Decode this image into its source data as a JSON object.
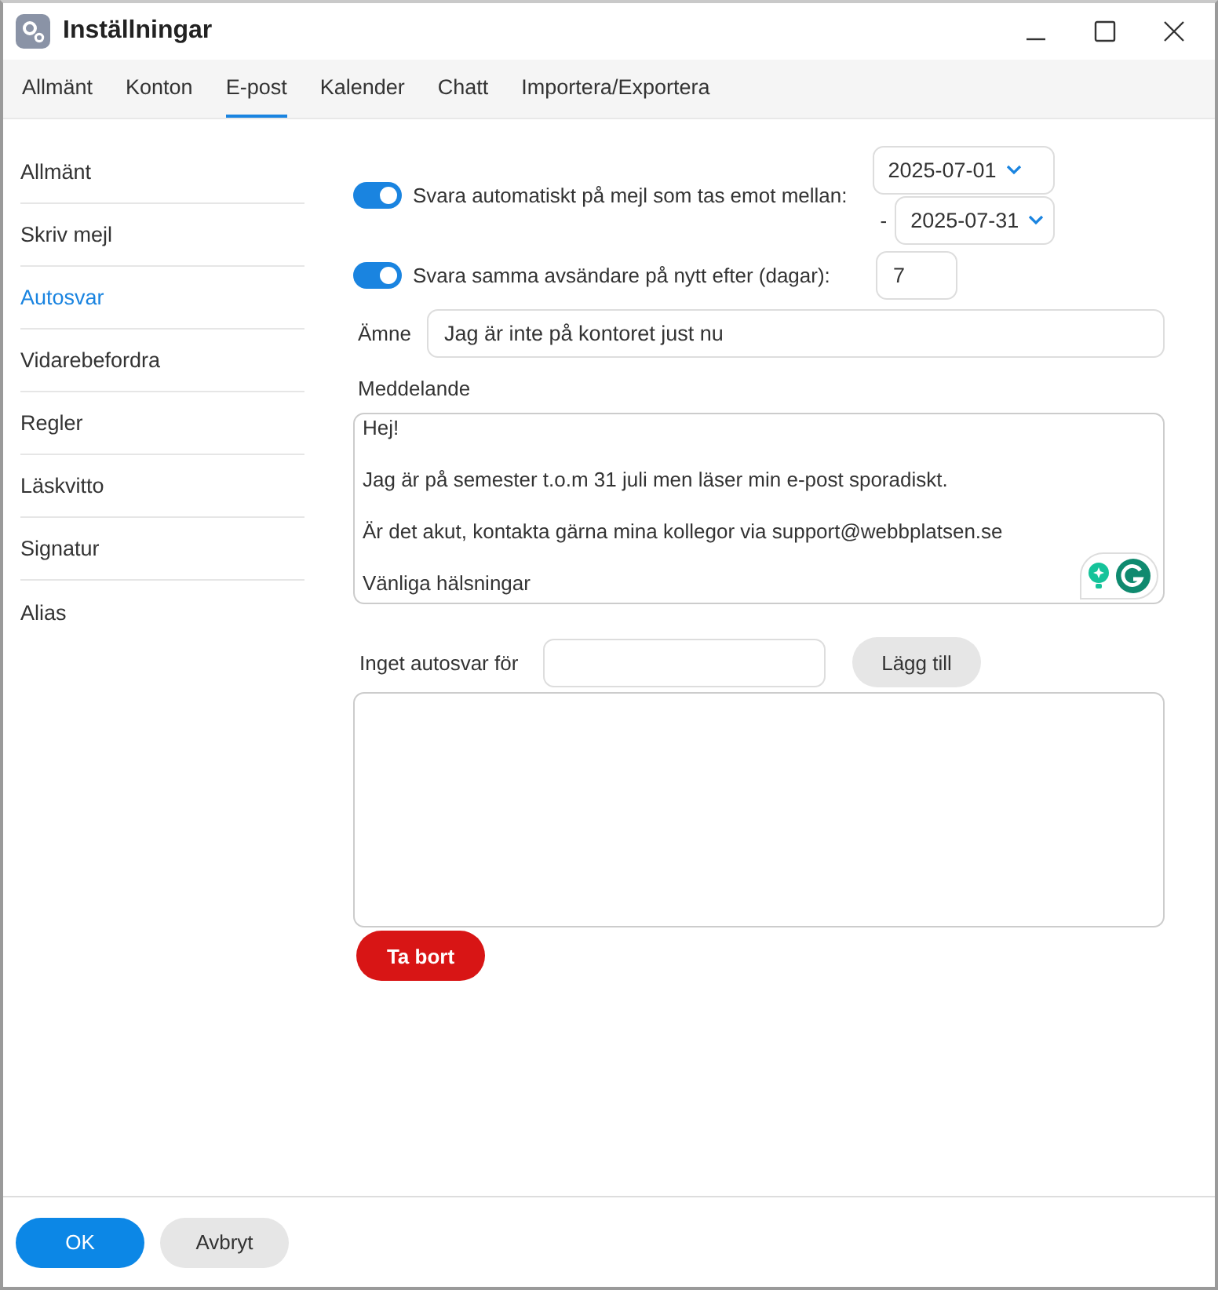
{
  "window": {
    "title": "Inställningar"
  },
  "tabs": [
    {
      "label": "Allmänt",
      "selected": false
    },
    {
      "label": "Konton",
      "selected": false
    },
    {
      "label": "E-post",
      "selected": true
    },
    {
      "label": "Kalender",
      "selected": false
    },
    {
      "label": "Chatt",
      "selected": false
    },
    {
      "label": "Importera/Exportera",
      "selected": false
    }
  ],
  "sidebar": {
    "items": [
      {
        "label": "Allmänt",
        "selected": false
      },
      {
        "label": "Skriv mejl",
        "selected": false
      },
      {
        "label": "Autosvar",
        "selected": true
      },
      {
        "label": "Vidarebefordra",
        "selected": false
      },
      {
        "label": "Regler",
        "selected": false
      },
      {
        "label": "Läskvitto",
        "selected": false
      },
      {
        "label": "Signatur",
        "selected": false
      },
      {
        "label": "Alias",
        "selected": false
      }
    ]
  },
  "auto_reply": {
    "period": {
      "on": true,
      "label": "Svara automatiskt på mejl som tas emot mellan:",
      "start": "2025-07-01",
      "separator": "-",
      "end": "2025-07-31"
    },
    "repeat": {
      "on": true,
      "label": "Svara samma avsändare på nytt efter (dagar):",
      "value": "7"
    },
    "subject": {
      "label": "Ämne",
      "value": "Jag är inte på kontoret just nu"
    },
    "message": {
      "label": "Meddelande",
      "value": "Hej!\n\nJag är på semester t.o.m 31 juli men läser min e-post sporadiskt.\n\nÄr det akut, kontakta gärna mina kollegor via support@webbplatsen.se\n\nVänliga hälsningar"
    },
    "exclude": {
      "label": "Inget autosvar för",
      "add_button": "Lägg till",
      "remove_button": "Ta bort"
    }
  },
  "footer": {
    "buttons": [
      {
        "label": "OK",
        "kind": "primary"
      },
      {
        "label": "Avbryt",
        "kind": "secondary"
      }
    ]
  }
}
